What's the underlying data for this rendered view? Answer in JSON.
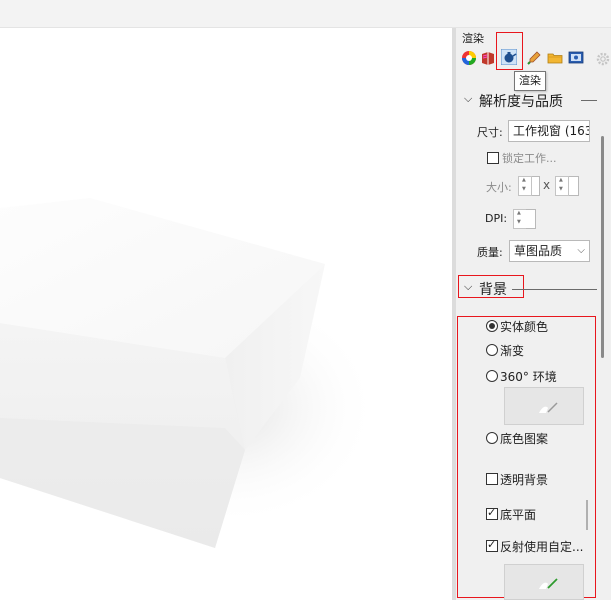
{
  "panel": {
    "title": "渲染",
    "tooltip": "渲染",
    "tabs": [
      {
        "icon": "color-wheel-icon",
        "active": false
      },
      {
        "icon": "material-book-icon",
        "active": false
      },
      {
        "icon": "render-teapot-icon",
        "active": true
      },
      {
        "icon": "dropper-icon",
        "active": false
      },
      {
        "icon": "folder-icon",
        "active": false
      },
      {
        "icon": "help-monitor-icon",
        "active": false
      },
      {
        "icon": "settings-gear-icon",
        "active": false
      }
    ],
    "resolution_section": {
      "title": "解析度与品质",
      "size_label": "尺寸:",
      "size_value": "工作视窗 (163",
      "lock_label": "锁定工作...",
      "dims_label": "大小:",
      "dims_sep": "x",
      "dpi_label": "DPI:",
      "quality_label": "质量:",
      "quality_value": "草图品质"
    },
    "background_section": {
      "title": "背景",
      "options": [
        {
          "label": "实体颜色",
          "selected": true
        },
        {
          "label": "渐变",
          "selected": false
        },
        {
          "label": "360° 环境",
          "selected": false
        },
        {
          "label": "底色图案",
          "selected": false
        }
      ],
      "transparent_label": "透明背景",
      "transparent_checked": false,
      "ground_label": "底平面",
      "ground_checked": true,
      "reflection_label": "反射使用自定...",
      "reflection_checked": true
    }
  },
  "colors": {
    "highlight": "#e8161d",
    "panel_bg": "#f0f0f0",
    "viewport_bg": "#ffffff"
  }
}
